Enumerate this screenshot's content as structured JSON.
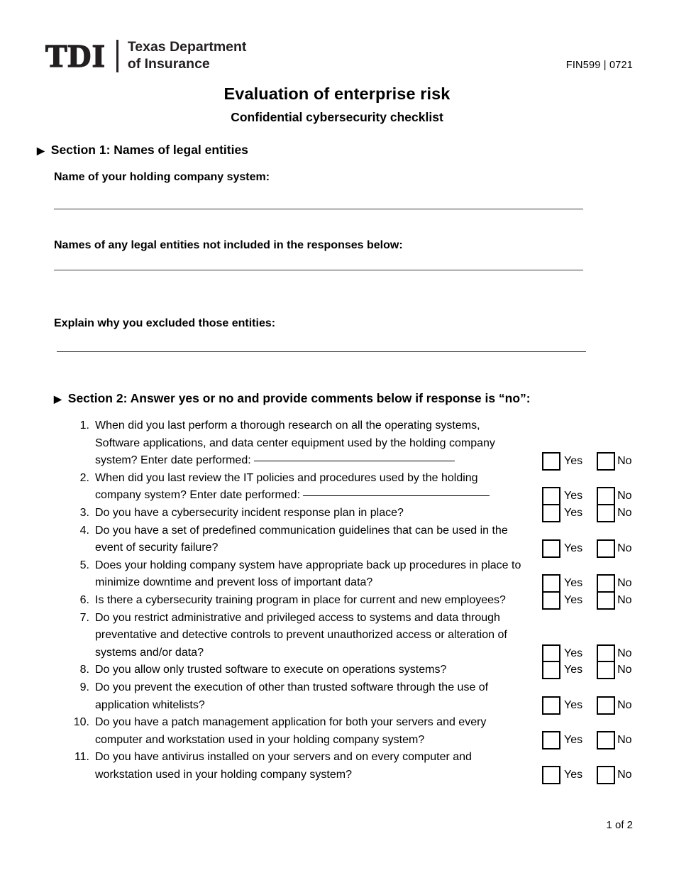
{
  "header": {
    "logo_mark": "TDI",
    "logo_name": "Texas Department\nof Insurance",
    "form_number": "FIN599 | 0721"
  },
  "title": "Evaluation of enterprise risk",
  "subtitle": "Confidential cybersecurity checklist",
  "section1": {
    "bullet": "▶",
    "heading": "Section 1: Names of legal entities",
    "fields": [
      {
        "label": "Name of your holding company system:",
        "value": ""
      },
      {
        "label": "Names of any legal entities not included in the responses below:",
        "value": ""
      },
      {
        "label": "Explain why you excluded those entities:",
        "value": ""
      }
    ]
  },
  "section2": {
    "bullet": "▶",
    "heading": "Section 2: Answer yes or no and provide comments below if response is “no”:",
    "yes_label": "Yes",
    "no_label": "No",
    "questions": [
      {
        "number": "1.",
        "text_before": "When did you last perform a thorough research on all the operating systems, Software applications, and data center equipment used by the holding company system?  Enter date performed:",
        "has_fill_line": true,
        "fill_value": "",
        "yes": false,
        "no": false
      },
      {
        "number": "2.",
        "text_before": "When did you last review the IT policies and procedures used by the holding company system? Enter date performed:",
        "has_fill_line": true,
        "fill_value": "",
        "yes": false,
        "no": false
      },
      {
        "number": "3.",
        "text_before": "Do you have a cybersecurity incident response plan in place?",
        "has_fill_line": false,
        "yes": false,
        "no": false
      },
      {
        "number": "4.",
        "text_before": "Do you have a set of predefined communication guidelines that can be used in the event of security failure?",
        "has_fill_line": false,
        "yes": false,
        "no": false
      },
      {
        "number": "5.",
        "text_before": "Does your holding company system have appropriate back up procedures in place to minimize downtime and prevent loss of important data?",
        "has_fill_line": false,
        "yes": false,
        "no": false
      },
      {
        "number": "6.",
        "text_before": "Is there a cybersecurity training program in place for current and new employees?",
        "has_fill_line": false,
        "yes": false,
        "no": false
      },
      {
        "number": "7.",
        "text_before": "Do you restrict administrative and privileged access to systems and data through preventative and detective controls to prevent unauthorized access or alteration of systems and/or data?",
        "has_fill_line": false,
        "yes": false,
        "no": false
      },
      {
        "number": "8.",
        "text_before": "Do you allow only trusted software to execute on operations systems?",
        "has_fill_line": false,
        "yes": false,
        "no": false
      },
      {
        "number": "9.",
        "text_before": "Do you prevent the execution of other than trusted software through the use of application whitelists?",
        "has_fill_line": false,
        "yes": false,
        "no": false
      },
      {
        "number": "10.",
        "text_before": "Do you have a patch management application for both your servers and every computer and workstation used in your holding company system?",
        "has_fill_line": false,
        "yes": false,
        "no": false
      },
      {
        "number": "11.",
        "text_before": "Do you have antivirus installed on your servers and on every computer and workstation used in your holding company system?",
        "has_fill_line": false,
        "yes": false,
        "no": false
      }
    ]
  },
  "footer": {
    "page_label": "1 of 2"
  },
  "colors": {
    "ink": "#000000",
    "logo": "#231f20",
    "rule": "#3a3a3a"
  }
}
